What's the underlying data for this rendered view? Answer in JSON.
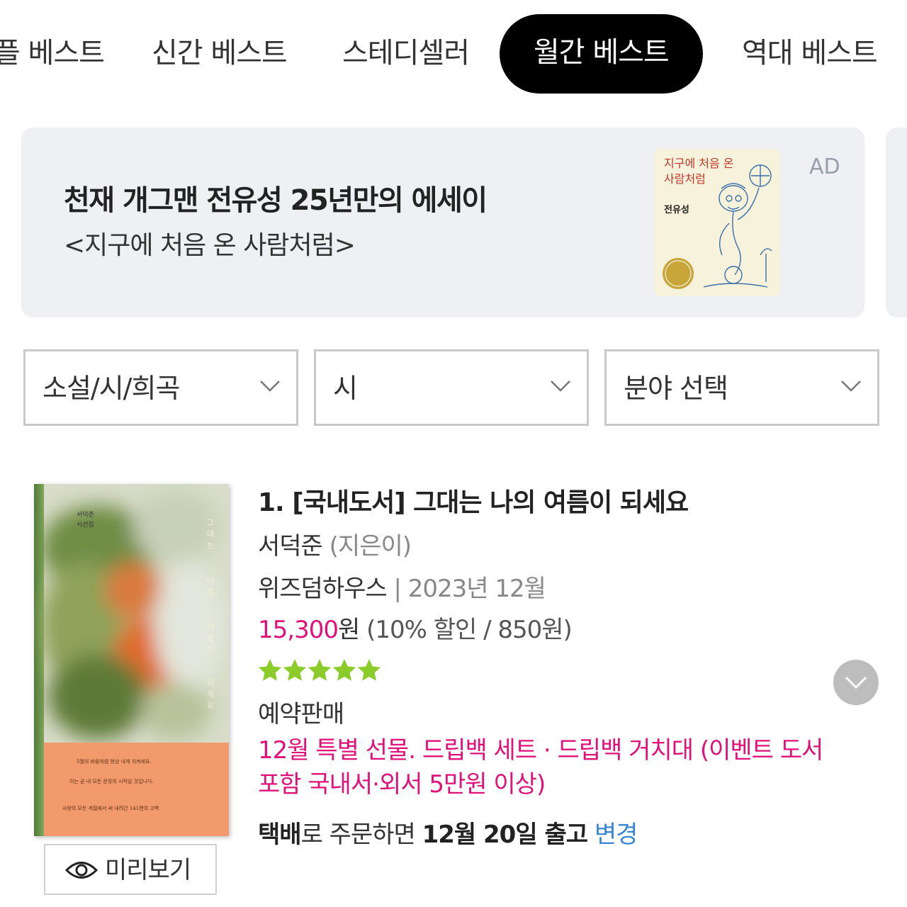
{
  "tabs": [
    {
      "label": "플 베스트"
    },
    {
      "label": "신간 베스트"
    },
    {
      "label": "스테디셀러"
    },
    {
      "label": "월간 베스트",
      "active": true
    },
    {
      "label": "역대 베스트"
    }
  ],
  "ad_banner": {
    "headline": "천재 개그맨 전유성 25년만의 에세이",
    "subtitle": "<지구에 처음 온 사람처럼>",
    "ad_label": "AD",
    "cover": {
      "title_line1": "지구에 처음 온",
      "title_line2": "사람처럼",
      "author": "전유성"
    }
  },
  "filters": [
    {
      "value": "소설/시/희곡"
    },
    {
      "value": "시"
    },
    {
      "value": "분야 선택"
    }
  ],
  "book": {
    "title": "1. [국내도서] 그대는 나의 여름이 되세요",
    "author": "서덕준",
    "author_role": "(지은이)",
    "publisher": "위즈덤하우스",
    "separator": "|",
    "pub_date": "2023년 12월",
    "sale_price": "15,300",
    "currency": "원",
    "discount": "(10% 할인 / 850원)",
    "rating_stars": 5,
    "status": "예약판매",
    "event": "12월 특별 선물. 드립백 세트 · 드립백 거치대 (이벤트 도서 포함 국내서·외서 5만원 이상)",
    "shipping": {
      "method": "택배",
      "text1": "로 주문하면 ",
      "date": "12월 20일 출고",
      "space": " ",
      "change_link": "변경"
    },
    "preview_label": "미리보기",
    "cover": {
      "top_text": "서덕준\n시선집",
      "vertical_title": "그대는 나의 여름이 되세요",
      "blurb1": "5월의 바람처럼 항상 내게 지켜세요.",
      "blurb2": "이는 곧 내 모든 문장의 시작일 것입니다.",
      "blurb3": "사랑의 모든 계절에서 써 내려간 141편의 고백"
    }
  },
  "colors": {
    "accent_pink": "#e0127a",
    "link_blue": "#3a86d6",
    "star_green": "#8ccc2a",
    "tab_active_bg": "#000000",
    "banner_bg": "#eef0f4"
  },
  "icons": [
    "chevron-down-icon",
    "eye-icon",
    "star-icon"
  ]
}
